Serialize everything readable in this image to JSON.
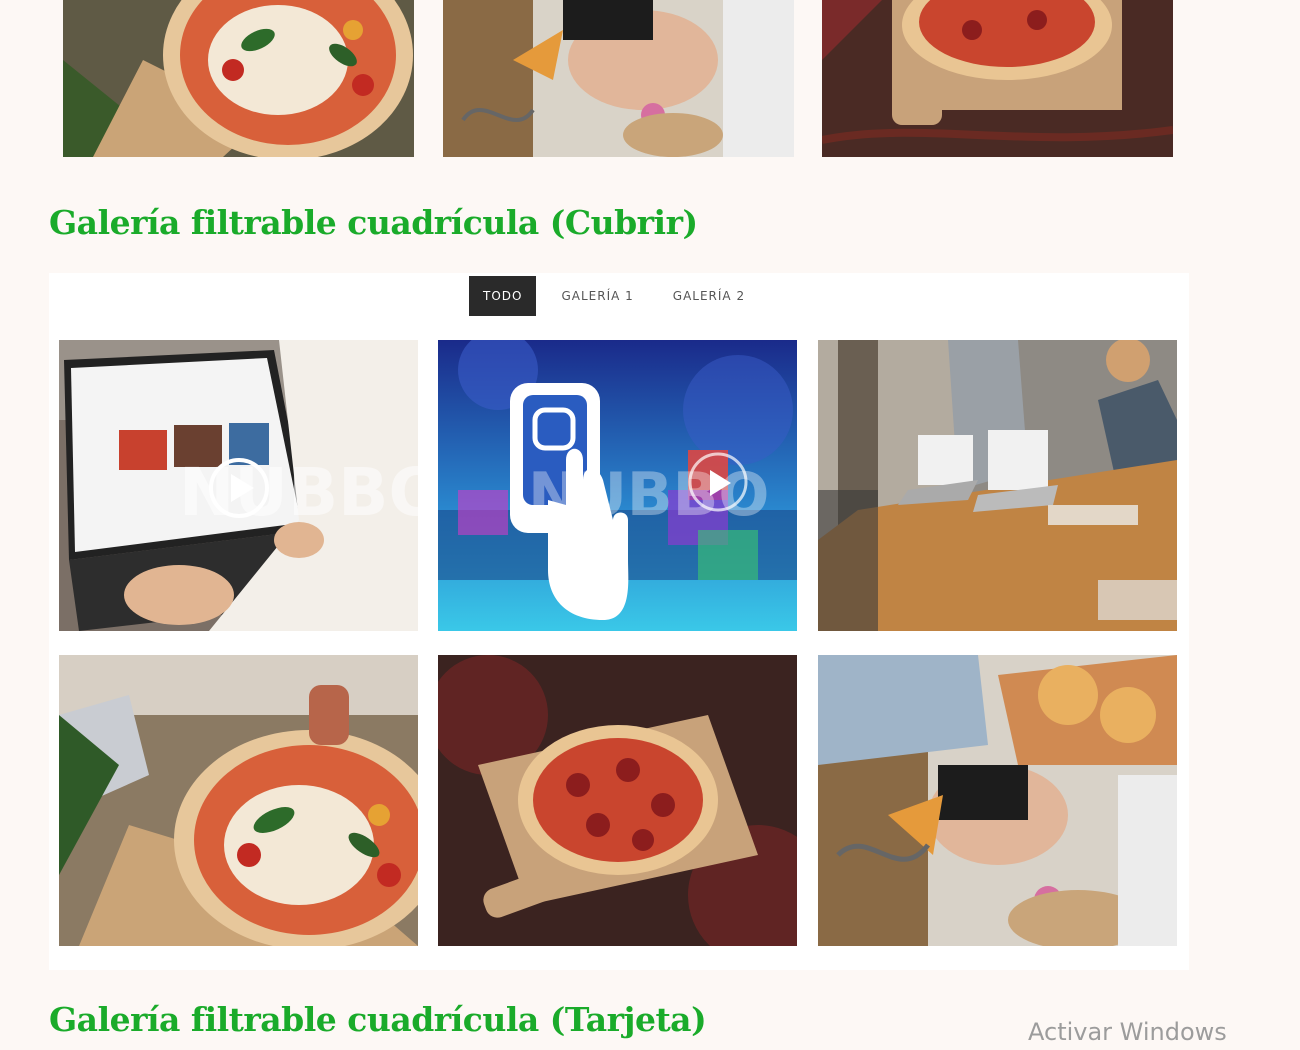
{
  "sections": {
    "cover_title": "Galería filtrable cuadrícula (Cubrir)",
    "card_title": "Galería filtrable cuadrícula (Tarjeta)"
  },
  "filters": [
    "TODO",
    "GALERÍA 1",
    "GALERÍA 2"
  ],
  "active_filter": "TODO",
  "windows_activation": "Activar Windows",
  "colors": {
    "heading": "#1aab2a",
    "active_filter": "#2a2a2a",
    "page_bg": "#fdf8f5"
  }
}
